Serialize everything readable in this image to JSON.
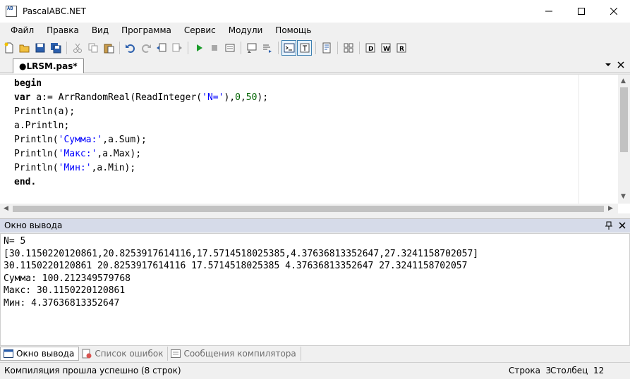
{
  "window": {
    "title": "PascalABC.NET",
    "icon_label": "AB"
  },
  "menu": [
    "Файл",
    "Правка",
    "Вид",
    "Программа",
    "Сервис",
    "Модули",
    "Помощь"
  ],
  "toolbar_icons": [
    "new-file-icon",
    "open-folder-icon",
    "save-icon",
    "save-all-icon",
    "cut-icon",
    "copy-icon",
    "paste-icon",
    "undo-icon",
    "redo-icon",
    "navigate-back-icon",
    "navigate-forward-icon",
    "run-icon",
    "stop-icon",
    "compile-icon",
    "debug-step-icon",
    "step-over-icon",
    "output-window-icon",
    "text-mode-icon",
    "format-icon",
    "form-designer-icon",
    "debug-icon-1",
    "debug-icon-2",
    "debug-icon-3"
  ],
  "editor": {
    "tab_label": "●LRSM.pas*",
    "lines": [
      [
        {
          "t": "begin",
          "c": "kw"
        }
      ],
      [
        {
          "t": "var",
          "c": "kw"
        },
        {
          "t": " a:= ArrRandomReal(ReadInteger(",
          "c": ""
        },
        {
          "t": "'N='",
          "c": "str"
        },
        {
          "t": "),",
          "c": ""
        },
        {
          "t": "0",
          "c": "num"
        },
        {
          "t": ",",
          "c": ""
        },
        {
          "t": "50",
          "c": "num"
        },
        {
          "t": ");",
          "c": ""
        }
      ],
      [
        {
          "t": "Println(a);",
          "c": ""
        }
      ],
      [
        {
          "t": "a.Println;",
          "c": ""
        }
      ],
      [
        {
          "t": "Println(",
          "c": ""
        },
        {
          "t": "'Сумма:'",
          "c": "str"
        },
        {
          "t": ",a.Sum);",
          "c": ""
        }
      ],
      [
        {
          "t": "Println(",
          "c": ""
        },
        {
          "t": "'Макс:'",
          "c": "str"
        },
        {
          "t": ",a.Max);",
          "c": ""
        }
      ],
      [
        {
          "t": "Println(",
          "c": ""
        },
        {
          "t": "'Мин:'",
          "c": "str"
        },
        {
          "t": ",a.Min);",
          "c": ""
        }
      ],
      [
        {
          "t": "end.",
          "c": "kw"
        }
      ]
    ]
  },
  "output_panel": {
    "title": "Окно вывода",
    "lines": [
      "N= 5",
      "[30.1150220120861,20.8253917614116,17.5714518025385,4.37636813352647,27.3241158702057]",
      "30.1150220120861 20.8253917614116 17.5714518025385 4.37636813352647 27.3241158702057",
      "Сумма: 100.212349579768",
      "Макс: 30.1150220120861",
      "Мин: 4.37636813352647"
    ]
  },
  "bottom_tabs": {
    "output": "Окно вывода",
    "errors": "Список ошибок",
    "compiler": "Сообщения компилятора"
  },
  "status": {
    "message": "Компиляция прошла успешно (8 строк)",
    "row": "Строка  3",
    "col": "Столбец  12"
  }
}
